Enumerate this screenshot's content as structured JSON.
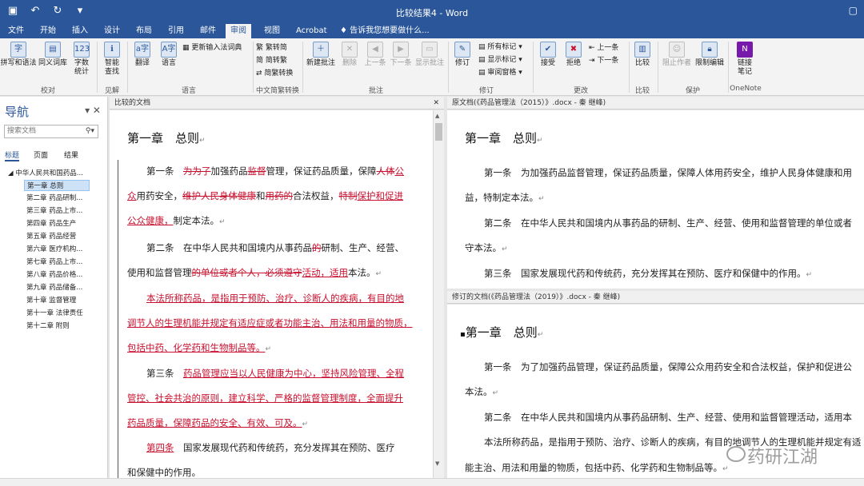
{
  "window": {
    "title": "比较结果4 - Word",
    "controls": "▢"
  },
  "quick_access": [
    "save-icon",
    "undo-icon",
    "redo-icon",
    "customize-icon"
  ],
  "tabs": [
    "文件",
    "开始",
    "插入",
    "设计",
    "布局",
    "引用",
    "邮件",
    "审阅",
    "视图",
    "Acrobat"
  ],
  "active_tab": "审阅",
  "tell_me": "告诉我您想要做什么...",
  "ribbon": {
    "proofing": {
      "spell": "拼写和语法",
      "thesaurus": "同义词库",
      "wordcount_1": "字数",
      "wordcount_2": "统计",
      "label": "校对"
    },
    "insights": {
      "smart_1": "智能",
      "smart_2": "查找",
      "label": "见解"
    },
    "language": {
      "translate": "翻译",
      "lang": "语言",
      "update_ime": "更新输入法词典",
      "label": "语言"
    },
    "chinese": {
      "to_simple": "繁转简",
      "to_trad": "简转繁",
      "convert": "简繁转换",
      "label": "中文简繁转换"
    },
    "comments": {
      "new": "新建批注",
      "delete": "删除",
      "prev": "上一条",
      "next": "下一条",
      "show": "显示批注",
      "label": "批注"
    },
    "tracking": {
      "track": "修订",
      "all_markup": "所有标记",
      "show_markup": "显示标记",
      "review_pane": "审阅窗格",
      "label": "修订"
    },
    "changes": {
      "accept": "接受",
      "reject": "拒绝",
      "prev": "上一条",
      "next": "下一条",
      "label": "更改"
    },
    "compare": {
      "compare": "比较",
      "label": "比较"
    },
    "protect": {
      "block": "阻止作者",
      "restrict": "限制编辑",
      "label": "保护"
    },
    "onenote": {
      "linked_1": "链接",
      "linked_2": "笔记",
      "label": "OneNote"
    }
  },
  "nav": {
    "title": "导航",
    "search_placeholder": "搜索文档",
    "tabs": [
      "标题",
      "页面",
      "结果"
    ],
    "root": "中华人民共和国药品...",
    "items": [
      "第一章 总则",
      "第二章 药品研制...",
      "第三章 药品上市...",
      "第四章 药品生产",
      "第五章 药品经营",
      "第六章 医疗机构...",
      "第七章 药品上市...",
      "第八章 药品价格...",
      "第九章 药品储备...",
      "第十章 监督管理",
      "第十一章 法律责任",
      "第十二章 附则"
    ],
    "selected_index": 0
  },
  "compared": {
    "header": "比较的文档",
    "heading": "第一章　总则",
    "p1_a": "第一条　",
    "p1_del1": "为为了",
    "p1_b": "加强药品",
    "p1_del2": "监督",
    "p1_c": "管理，保证药品质量，保障",
    "p1_del3": "人体",
    "p1_ins1": "公",
    "p1_ins2": "众",
    "p1_d": "用药安全，",
    "p1_del4": "维护人民身体健康",
    "p1_e": "和",
    "p1_del5": "用药的",
    "p1_f": "合法权益，",
    "p1_del6": "特制",
    "p1_ins3": "保护和促进",
    "p1_ins4": "公众健康，",
    "p1_g": "制定本法。",
    "p2_a": "第二条　在中华人民共和国境内从事药品",
    "p2_del1": "的",
    "p2_b": "研制、生产、经营、",
    "p2_c": "使用和监督管理",
    "p2_del2": "的单位或者个人，必须遵守",
    "p2_ins1": "活动，适用",
    "p2_d": "本法。",
    "p3_l1": "本法所称药品，是指用于预防、治疗、诊断人的疾病，有目的地",
    "p3_l2": "调节人的生理机能并规定有适应症或者功能主治、用法和用量的物质，",
    "p3_l3": "包括中药、化学药和生物制品等。",
    "p4_a": "第三条　",
    "p4_l1": "药品管理应当以人民健康为中心，坚持风险管理、全程",
    "p4_l2": "管控、社会共治的原则，建立科学、严格的监督管理制度，全面提升",
    "p4_l3": "药品质量，保障药品的安全、有效、可及。",
    "p5_ins": "第四条",
    "p5_a": "　国家发展现代药和传统药，充分发挥其在预防、医疗",
    "p5_l2": "和保健中的作用。"
  },
  "original": {
    "header": "原文档(《药品管理法（2015）》.docx - 秦 继峰)",
    "heading": "第一章　总则",
    "l1": "第一条　为加强药品监督管理，保证药品质量，保障人体用药安全，维护人民身体健康和用",
    "l2": "益，特制定本法。",
    "l3": "第二条　在中华人民共和国境内从事药品的研制、生产、经营、使用和监督管理的单位或者",
    "l4": "守本法。",
    "l5": "第三条　国家发展现代药和传统药，充分发挥其在预防、医疗和保健中的作用。"
  },
  "revised": {
    "header": "修订的文档(《药品管理法（2019）》.docx - 秦 继峰)",
    "heading": "第一章　总则",
    "l1": "第一条　为了加强药品管理，保证药品质量，保障公众用药安全和合法权益，保护和促进公",
    "l2": "本法。",
    "l3": "第二条　在中华人民共和国境内从事药品研制、生产、经营、使用和监督管理活动，适用本",
    "l4": "本法所称药品，是指用于预防、治疗、诊断人的疾病，有目的地调节人的生理机能并规定有适",
    "l5": "能主治、用法和用量的物质，包括中药、化学药和生物制品等。"
  },
  "watermark": "药研江湖",
  "pilcrow": "↵"
}
